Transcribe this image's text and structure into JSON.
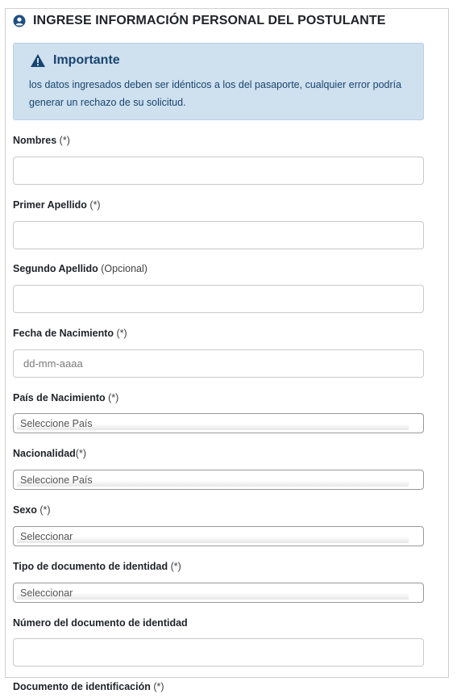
{
  "header": {
    "title": "INGRESE INFORMACIÓN PERSONAL DEL POSTULANTE"
  },
  "alert": {
    "title": "Importante",
    "body": "los datos ingresados deben ser idénticos a los del pasaporte, cualquier error podría generar un rechazo de su solicitud."
  },
  "fields": {
    "nombres": {
      "label": "Nombres",
      "req": "(*)",
      "value": ""
    },
    "primer_apellido": {
      "label": "Primer Apellido",
      "req": "(*)",
      "value": ""
    },
    "segundo_apellido": {
      "label": "Segundo Apellido",
      "req": "(Opcional)",
      "value": ""
    },
    "fecha_nacimiento": {
      "label": "Fecha de Nacimiento",
      "req": "(*)",
      "placeholder": "dd-mm-aaaa",
      "value": ""
    },
    "pais_nacimiento": {
      "label": "País de Nacimiento",
      "req": "(*)",
      "selected": "Seleccione País"
    },
    "nacionalidad": {
      "label": "Nacionalidad",
      "req": "(*)",
      "selected": "Seleccione País"
    },
    "sexo": {
      "label": "Sexo",
      "req": "(*)",
      "selected": "Seleccionar"
    },
    "tipo_documento": {
      "label": "Tipo de documento de identidad",
      "req": "(*)",
      "selected": "Seleccionar"
    },
    "numero_documento": {
      "label": "Número del documento de identidad",
      "req": "",
      "value": ""
    },
    "documento_identificacion": {
      "label": "Documento de identificación",
      "req": "(*)"
    }
  },
  "colors": {
    "accent": "#18456f",
    "alert_bg": "#cfe0ef",
    "border": "#c9c9c9"
  },
  "icons": {
    "header": "user-circle-icon",
    "alert": "warning-triangle-icon"
  }
}
